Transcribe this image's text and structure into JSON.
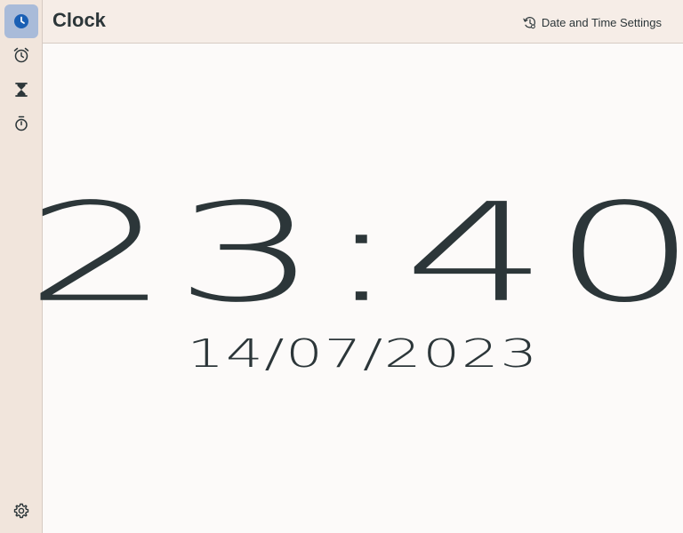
{
  "app": {
    "title": "Clock"
  },
  "header": {
    "settings_label": "Date and Time Settings"
  },
  "sidebar": {
    "items": [
      {
        "name": "clock",
        "icon": "clock-icon",
        "active": true
      },
      {
        "name": "alarm",
        "icon": "alarm-icon",
        "active": false
      },
      {
        "name": "timer",
        "icon": "hourglass-icon",
        "active": false
      },
      {
        "name": "stopwatch",
        "icon": "stopwatch-icon",
        "active": false
      }
    ],
    "bottom": {
      "name": "settings",
      "icon": "gear-icon"
    }
  },
  "clock": {
    "time": "23:40",
    "date": "14/07/2023"
  },
  "colors": {
    "accent": "#1a5fb4",
    "text": "#2c3639",
    "sidebar_bg": "#f1e5dc",
    "active_bg": "#a9bbd9"
  }
}
